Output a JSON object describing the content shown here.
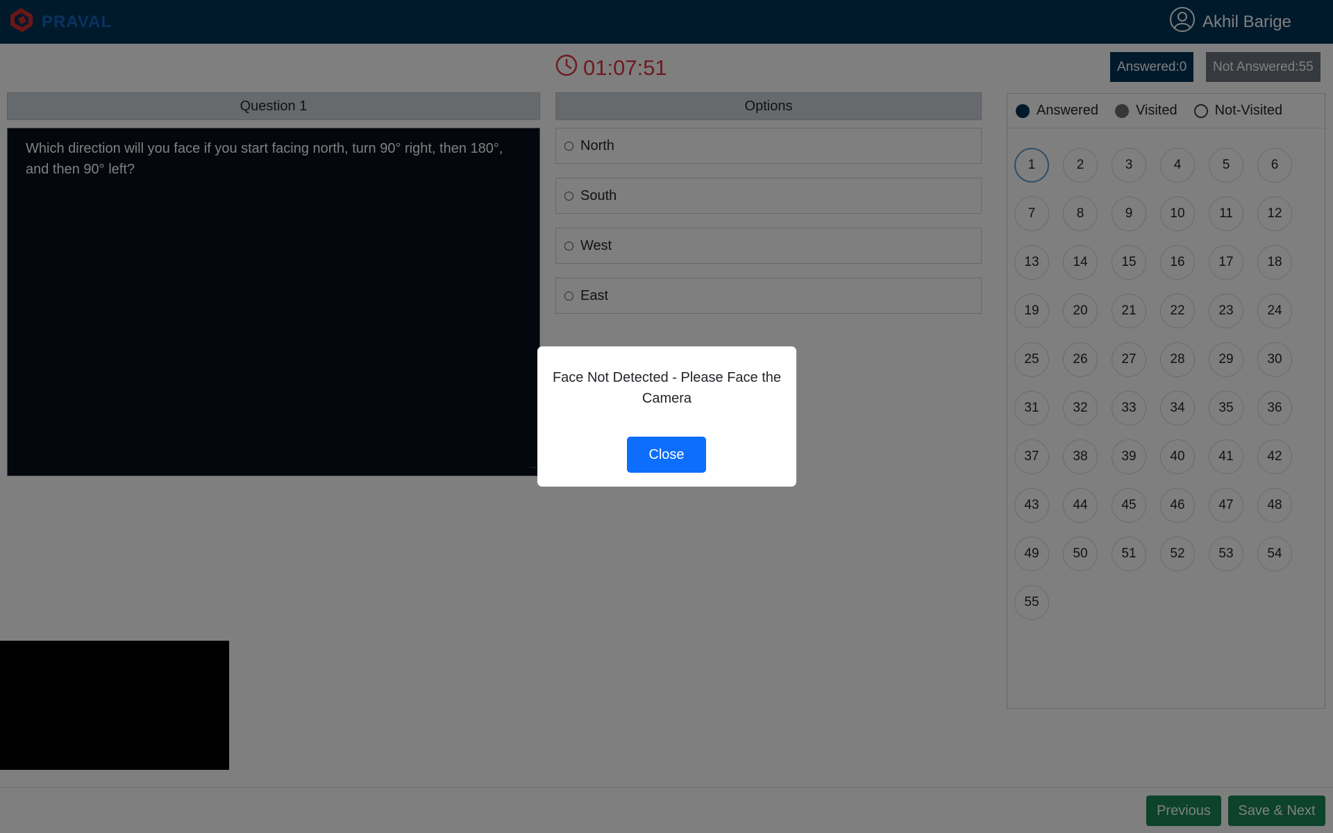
{
  "header": {
    "brand": "PRAVAL",
    "user_name": "Akhil Barige"
  },
  "timer": {
    "value": "01:07:51"
  },
  "status": {
    "answered": "Answered:0",
    "not_answered": "Not Answered:55"
  },
  "question": {
    "heading": "Question 1",
    "text": "Which direction will you face if you start facing north, turn 90° right, then 180°, and then 90° left?"
  },
  "options": {
    "heading": "Options",
    "items": [
      "North",
      "South",
      "West",
      "East"
    ]
  },
  "palette": {
    "legend": {
      "answered": "Answered",
      "visited": "Visited",
      "not_visited": "Not-Visited"
    },
    "numbers": [
      "1",
      "2",
      "3",
      "4",
      "5",
      "6",
      "7",
      "8",
      "9",
      "10",
      "11",
      "12",
      "13",
      "14",
      "15",
      "16",
      "17",
      "18",
      "19",
      "20",
      "21",
      "22",
      "23",
      "24",
      "25",
      "26",
      "27",
      "28",
      "29",
      "30",
      "31",
      "32",
      "33",
      "34",
      "35",
      "36",
      "37",
      "38",
      "39",
      "40",
      "41",
      "42",
      "43",
      "44",
      "45",
      "46",
      "47",
      "48",
      "49",
      "50",
      "51",
      "52",
      "53",
      "54",
      "55"
    ],
    "current": "1"
  },
  "footer": {
    "previous": "Previous",
    "save_next": "Save & Next"
  },
  "modal": {
    "message": "Face Not Detected - Please Face the Camera",
    "close": "Close"
  },
  "colors": {
    "header_bg": "#003459",
    "timer": "#dc3545",
    "primary_button": "#0d6efd",
    "nav_button": "#198754"
  },
  "icons": {
    "brand": "praval-logo-icon",
    "user": "user-circle-icon",
    "timer": "clock-icon"
  }
}
